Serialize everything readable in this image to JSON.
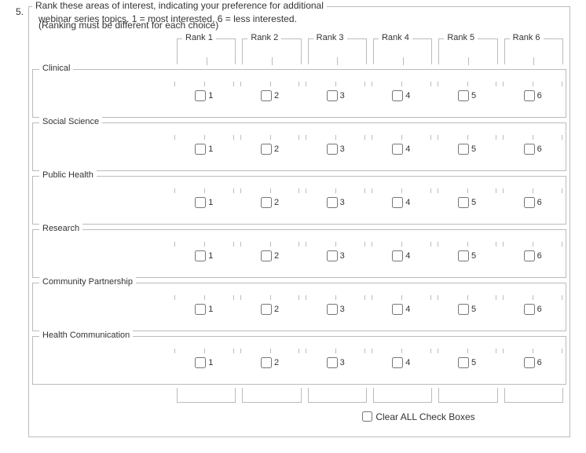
{
  "question": {
    "number": "5.",
    "line1": "Rank these areas of interest, indicating your preference for additional",
    "line2": "webinar series topics. 1 = most interested, 6 = less interested.",
    "line3": "(Ranking must be different for each choice)"
  },
  "ranks": [
    "Rank 1",
    "Rank 2",
    "Rank 3",
    "Rank 4",
    "Rank 5",
    "Rank 6"
  ],
  "rank_numbers": [
    "1",
    "2",
    "3",
    "4",
    "5",
    "6"
  ],
  "items": [
    "Clinical",
    "Social Science",
    "Public Health",
    "Research",
    "Community Partnership",
    "Health Communication"
  ],
  "clear_label": "Clear ALL Check Boxes"
}
